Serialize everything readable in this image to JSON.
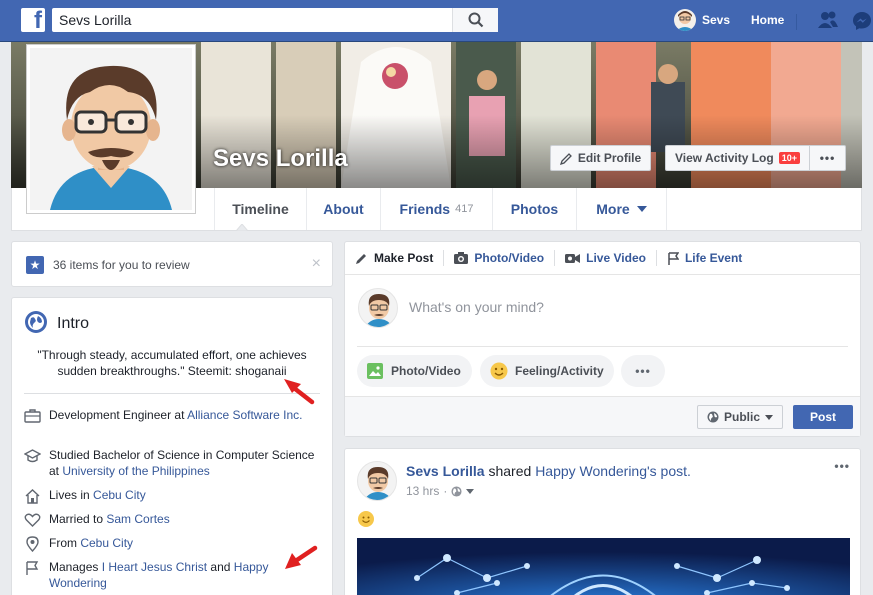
{
  "topbar": {
    "logo": "f",
    "search_value": "Sevs Lorilla",
    "user_name": "Sevs",
    "home_label": "Home"
  },
  "profile": {
    "name": "Sevs Lorilla",
    "edit_profile_label": "Edit Profile",
    "view_activity_label": "View Activity Log",
    "activity_badge": "10+",
    "more_dots": "•••"
  },
  "tabs": [
    {
      "label": "Timeline"
    },
    {
      "label": "About"
    },
    {
      "label": "Friends",
      "count": "417"
    },
    {
      "label": "Photos"
    },
    {
      "label": "More"
    }
  ],
  "review": {
    "text": "36 items for you to review",
    "close": "×"
  },
  "intro": {
    "title": "Intro",
    "quote": "\"Through steady, accumulated effort, one achieves sudden breakthroughs.\" Steemit: shoganaii",
    "items": [
      {
        "icon": "briefcase-icon",
        "prefix": "Development Engineer at ",
        "link": "Alliance Software Inc.",
        "suffix": ""
      },
      {
        "icon": "graduation-cap-icon",
        "prefix": "Studied Bachelor of Science in Computer Science at ",
        "link": "University of the Philippines",
        "suffix": ""
      },
      {
        "icon": "home-icon",
        "prefix": "Lives in ",
        "link": "Cebu City",
        "suffix": ""
      },
      {
        "icon": "heart-icon",
        "prefix": "Married to ",
        "link": "Sam Cortes",
        "suffix": ""
      },
      {
        "icon": "location-pin-icon",
        "prefix": "From ",
        "link": "Cebu City",
        "suffix": ""
      },
      {
        "icon": "flag-icon",
        "prefix": "Manages ",
        "link": "I Heart Jesus Christ",
        "mid": " and ",
        "link2": "Happy Wondering"
      }
    ]
  },
  "composer": {
    "tabs": [
      {
        "label": "Make Post",
        "icon": "pencil-icon"
      },
      {
        "label": "Photo/Video",
        "icon": "camera-icon"
      },
      {
        "label": "Live Video",
        "icon": "video-camera-icon"
      },
      {
        "label": "Life Event",
        "icon": "flag-icon"
      }
    ],
    "placeholder": "What's on your mind?",
    "photo_video_label": "Photo/Video",
    "feeling_label": "Feeling/Activity",
    "more_dots": "•••",
    "public_label": "Public",
    "post_label": "Post"
  },
  "post": {
    "author": "Sevs Lorilla",
    "action": " shared ",
    "shared_from": "Happy Wondering's post.",
    "time": "13 hrs",
    "dots": "•••"
  },
  "colors": {
    "brand": "#4267b2",
    "link": "#365899",
    "badge": "#fa3e3e",
    "arrow": "#e02020"
  }
}
